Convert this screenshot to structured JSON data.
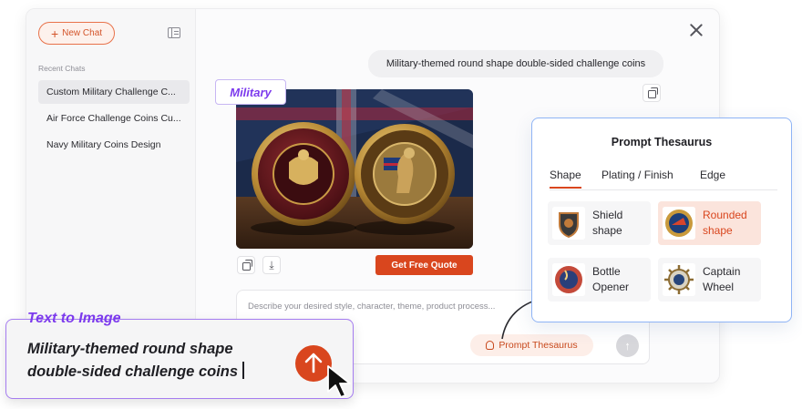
{
  "sidebar": {
    "new_chat_label": "New Chat",
    "recent_label": "Recent Chats",
    "items": [
      {
        "label": "Custom Military Challenge C..."
      },
      {
        "label": "Air Force Challenge Coins Cu..."
      },
      {
        "label": "Navy Military Coins Design"
      }
    ]
  },
  "chat": {
    "user_message": "Military-themed round shape double-sided challenge coins",
    "style_tag": "Military",
    "quote_button": "Get Free Quote",
    "input_placeholder": "Describe your desired style, character, theme, product process...",
    "thesaurus_button": "Prompt Thesaurus"
  },
  "thesaurus": {
    "title": "Prompt Thesaurus",
    "tabs": [
      {
        "label": "Shape"
      },
      {
        "label": "Plating / Finish"
      },
      {
        "label": "Edge"
      }
    ],
    "options": [
      {
        "label": "Shield shape"
      },
      {
        "label": "Rounded shape"
      },
      {
        "label": "Bottle Opener"
      },
      {
        "label": "Captain Wheel"
      }
    ]
  },
  "callout": {
    "label": "Text to Image",
    "prompt": "Military-themed round shape double-sided challenge coins"
  },
  "colors": {
    "accent": "#d9461e",
    "purple": "#7c3aed",
    "popup_border": "#8fb4f5"
  }
}
